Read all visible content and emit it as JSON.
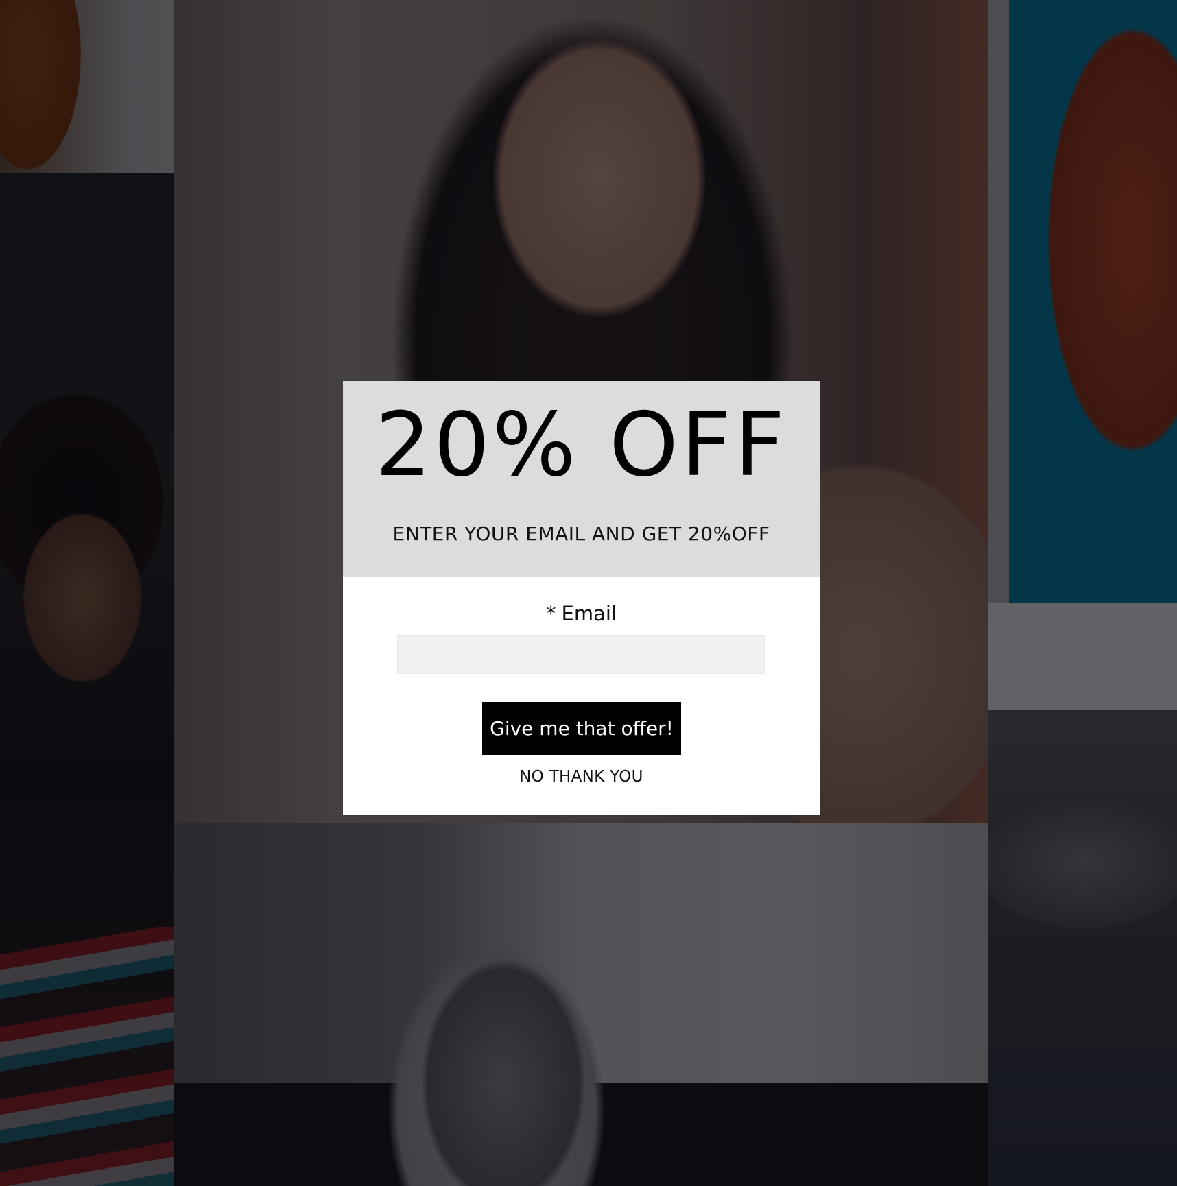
{
  "popup": {
    "headline": "20% OFF",
    "subheadline": "ENTER YOUR EMAIL AND GET 20%OFF",
    "email_required_marker": "*",
    "email_label": "Email",
    "email_value": "",
    "email_placeholder": "",
    "submit_label": "Give me that offer!",
    "decline_label": "NO THANK YOU"
  },
  "colors": {
    "header_background": "#dcdcdc",
    "body_background": "#ffffff",
    "input_background": "#f1f1ef",
    "button_background": "#000000",
    "button_text": "#ffffff"
  }
}
